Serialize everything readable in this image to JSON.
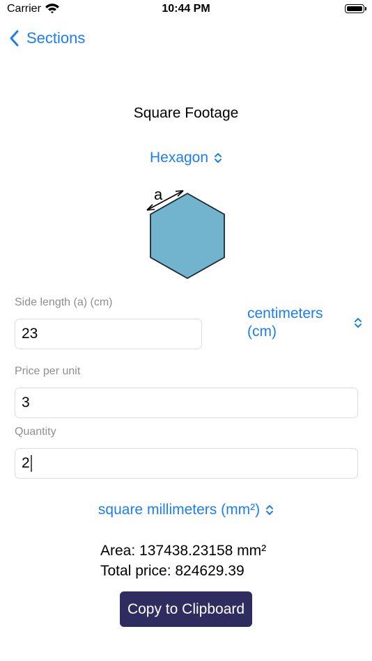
{
  "status_bar": {
    "carrier": "Carrier",
    "time": "10:44 PM"
  },
  "nav": {
    "back_label": "Sections"
  },
  "title": "Square Footage",
  "shape_picker": {
    "selected": "Hexagon"
  },
  "diagram": {
    "side_label": "a"
  },
  "side_length": {
    "label": "Side length (a) (cm)",
    "value": "23"
  },
  "length_unit": {
    "selected": "centimeters (cm)"
  },
  "price_per_unit": {
    "label": "Price per unit",
    "value": "3"
  },
  "quantity": {
    "label": "Quantity",
    "value": "2"
  },
  "area_unit": {
    "selected": "square millimeters (mm²)"
  },
  "results": {
    "area": "Area: 137438.23158 mm²",
    "total_price": "Total price: 824629.39"
  },
  "copy_button": {
    "label": "Copy to Clipboard"
  },
  "colors": {
    "accent": "#1a7ef5",
    "hexagon_fill": "#72b4cd",
    "button_bg": "#2f2d5f"
  },
  "icons": [
    "wifi-icon",
    "battery-icon",
    "chevron-left-icon",
    "chevron-up-down-icon"
  ]
}
